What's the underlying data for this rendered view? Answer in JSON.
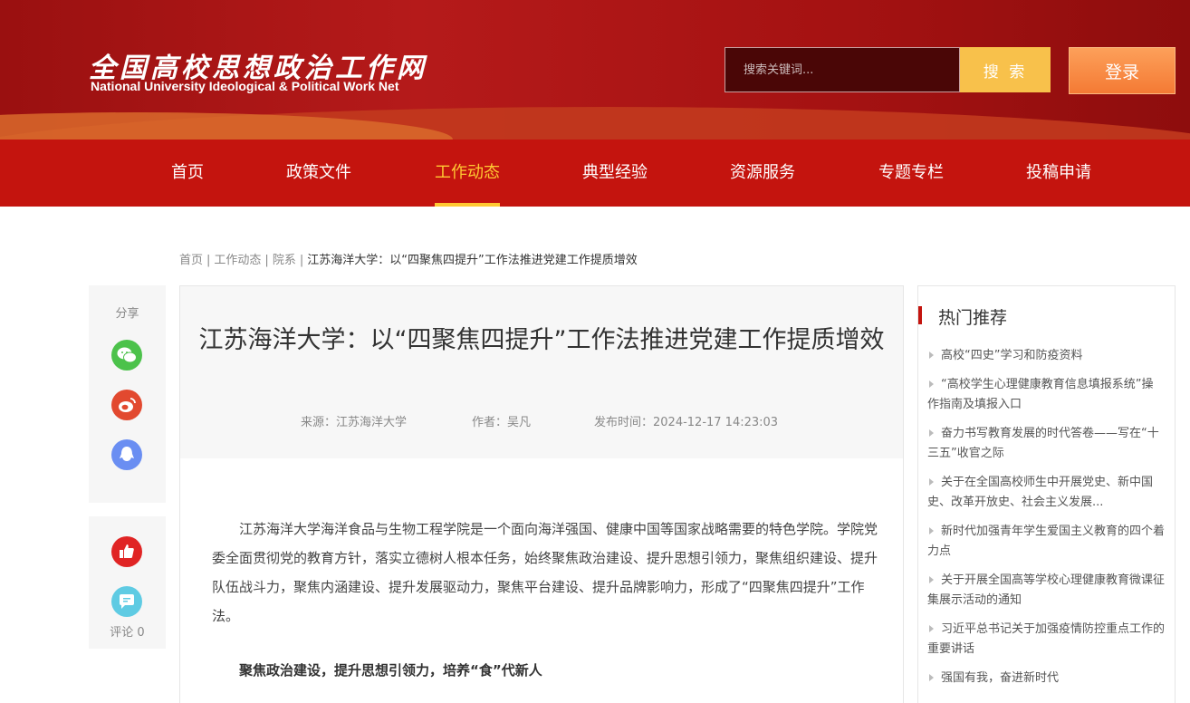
{
  "site": {
    "logo_cn": "全国高校思想政治工作网",
    "logo_en": "National University Ideological & Political Work Net"
  },
  "search": {
    "placeholder": "搜索关键词...",
    "button": "搜 索"
  },
  "login": "登录",
  "nav": [
    "首页",
    "政策文件",
    "工作动态",
    "典型经验",
    "资源服务",
    "专题专栏",
    "投稿申请"
  ],
  "nav_active": "工作动态",
  "breadcrumb": [
    "首页",
    "工作动态",
    "院系",
    "江苏海洋大学：以“四聚焦四提升”工作法推进党建工作提质增效"
  ],
  "share": {
    "label": "分享",
    "icons": [
      "wechat-icon",
      "weibo-icon",
      "qq-icon"
    ]
  },
  "actions": {
    "comment_label": "评论 0",
    "icons": [
      "like-icon",
      "comment-icon"
    ]
  },
  "article": {
    "title": "江苏海洋大学：以“四聚焦四提升”工作法推进党建工作提质增效",
    "source": "来源：江苏海洋大学",
    "author": "作者：吴凡",
    "time": "发布时间：2024-12-17 14:23:03",
    "paragraph": "江苏海洋大学海洋食品与生物工程学院是一个面向海洋强国、健康中国等国家战略需要的特色学院。学院党委全面贯彻党的教育方针，落实立德树人根本任务，始终聚焦政治建设、提升思想引领力，聚焦组织建设、提升队伍战斗力，聚焦内涵建设、提升发展驱动力，聚焦平台建设、提升品牌影响力，形成了“四聚焦四提升”工作法。",
    "subheading": "聚焦政治建设，提升思想引领力，培养“食”代新人"
  },
  "sidebar": {
    "title": "热门推荐",
    "items": [
      "高校“四史”学习和防疫资料",
      "“高校学生心理健康教育信息填报系统”操作指南及填报入口",
      "奋力书写教育发展的时代答卷——写在“十三五”收官之际",
      "关于在全国高校师生中开展党史、新中国史、改革开放史、社会主义发展...",
      "新时代加强青年学生爱国主义教育的四个着力点",
      "关于开展全国高等学校心理健康教育微课征集展示活动的通知",
      "习近平总书记关于加强疫情防控重点工作的重要讲话",
      "强国有我，奋进新时代"
    ]
  },
  "colors": {
    "brand_red": "#c4140e",
    "accent_gold": "#ffc933",
    "search_btn": "#f8c14b",
    "login_btn": "#f47a34"
  }
}
